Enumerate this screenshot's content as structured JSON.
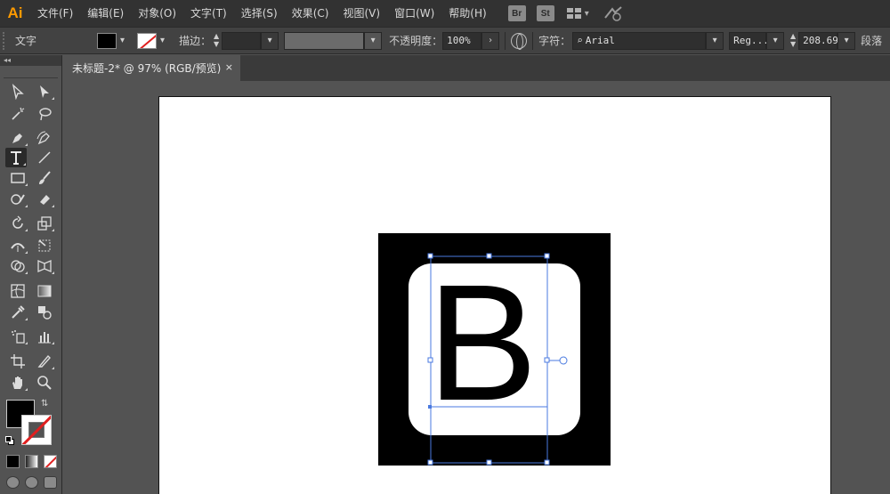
{
  "app": {
    "logo": "Ai",
    "menus": [
      "文件(F)",
      "编辑(E)",
      "对象(O)",
      "文字(T)",
      "选择(S)",
      "效果(C)",
      "视图(V)",
      "窗口(W)",
      "帮助(H)"
    ],
    "badges": [
      "Br",
      "St"
    ]
  },
  "control": {
    "tool_name": "文字",
    "stroke_label": "描边：",
    "opacity_label": "不透明度：",
    "opacity_value": "100%",
    "char_label": "字符：",
    "font_value": "Arial",
    "style_value": "Reg...",
    "size_value": "208.69",
    "para_label": "段落"
  },
  "document": {
    "tab_title": "未标题-2* @ 97% (RGB/预览)",
    "tab_close": "×"
  },
  "toolbox": {
    "header": "◂◂"
  },
  "artwork": {
    "letter": "B",
    "background_color": "#000000",
    "badge_color": "#ffffff",
    "selection_color": "#4a7ae0"
  },
  "colors": {
    "accent": "#ff9a00",
    "menubar": "#323232",
    "panel": "#424242",
    "workspace": "#535353"
  }
}
